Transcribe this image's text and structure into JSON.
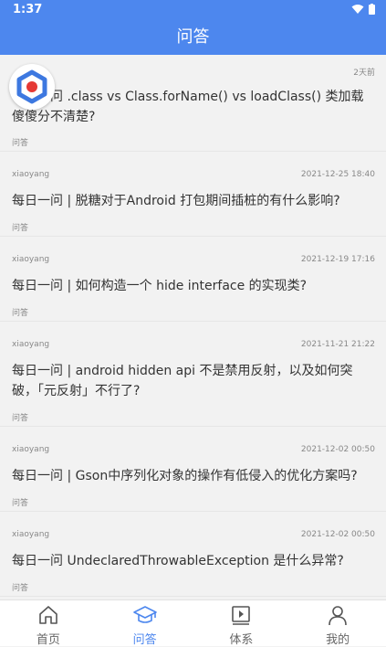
{
  "status_bar": {
    "time": "1:37"
  },
  "app_bar": {
    "title": "问答"
  },
  "questions": [
    {
      "author": "",
      "date": "2天前",
      "title": "每日一问 .class vs Class.forName() vs loadClass() 类加载傻傻分不清楚?",
      "category": "问答"
    },
    {
      "author": "xiaoyang",
      "date": "2021-12-25 18:40",
      "title": "每日一问 | 脱糖对于Android 打包期间插桩的有什么影响?",
      "category": "问答"
    },
    {
      "author": "xiaoyang",
      "date": "2021-12-19 17:16",
      "title": "每日一问 | 如何构造一个 hide interface 的实现类?",
      "category": "问答"
    },
    {
      "author": "xiaoyang",
      "date": "2021-11-21 21:22",
      "title": "每日一问 | android hidden api 不是禁用反射，以及如何突破，「元反射」不行了?",
      "category": "问答"
    },
    {
      "author": "xiaoyang",
      "date": "2021-12-02 00:50",
      "title": "每日一问 | Gson中序列化对象的操作有低侵入的优化方案吗?",
      "category": "问答"
    },
    {
      "author": "xiaoyang",
      "date": "2021-12-02 00:50",
      "title": "每日一问 UndeclaredThrowableException 是什么异常?",
      "category": "问答"
    }
  ],
  "tabs": [
    {
      "label": "首页",
      "icon": "home-icon",
      "active": false
    },
    {
      "label": "问答",
      "icon": "graduation-cap-icon",
      "active": true
    },
    {
      "label": "体系",
      "icon": "media-play-icon",
      "active": false
    },
    {
      "label": "我的",
      "icon": "person-icon",
      "active": false
    }
  ],
  "colors": {
    "primary": "#4d87ee",
    "background": "#f2f2f2",
    "text": "#333333",
    "muted": "#888888"
  }
}
